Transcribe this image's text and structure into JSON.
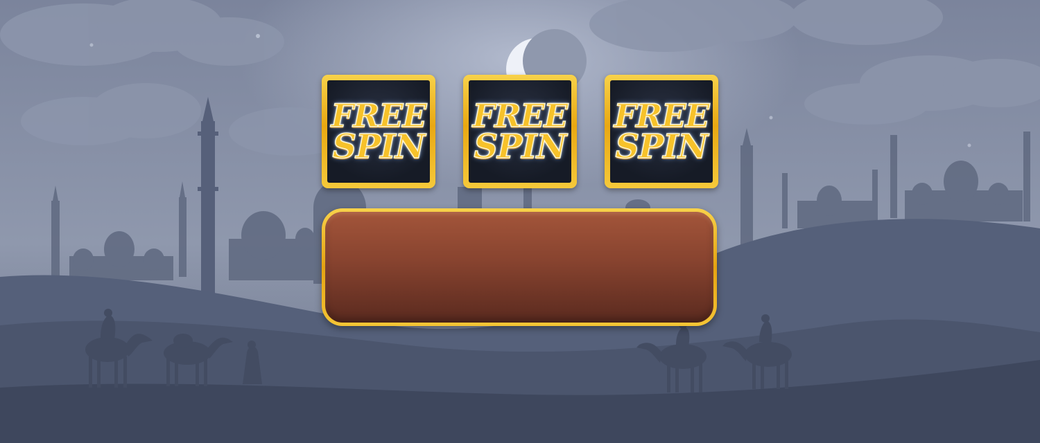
{
  "symbols": [
    {
      "id": "free-spin",
      "line1": "FREE",
      "line2": "SPIN"
    },
    {
      "id": "free-spin",
      "line1": "FREE",
      "line2": "SPIN"
    },
    {
      "id": "free-spin",
      "line1": "FREE",
      "line2": "SPIN"
    }
  ],
  "result_panel": {
    "text": ""
  },
  "colors": {
    "sky": "#7c869f",
    "silhouette": "#4a5468",
    "gold": "#f2b823",
    "panel": "#8a4631"
  }
}
